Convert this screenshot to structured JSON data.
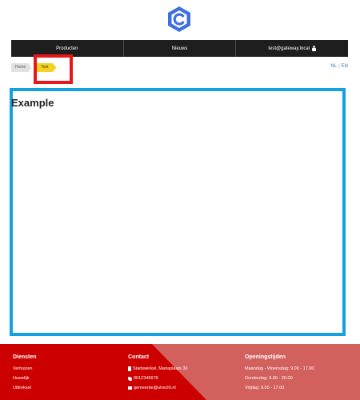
{
  "header": {
    "logo": "c-hexagon-logo"
  },
  "nav": {
    "items": [
      {
        "label": "Producten"
      },
      {
        "label": "Nieuws"
      },
      {
        "label": "test@gateway.local"
      }
    ]
  },
  "breadcrumb": {
    "home": "Home",
    "current": "Test"
  },
  "language": {
    "nl": "NL",
    "separator": "|",
    "en": "EN"
  },
  "main": {
    "title": "Example"
  },
  "footer": {
    "services": {
      "heading": "Diensten",
      "items": [
        "Verhuizen",
        "Huwelijk",
        "Uittreksel"
      ]
    },
    "contact": {
      "heading": "Contact",
      "address": "Stadswinkel, Mariaplaats 30",
      "phone": "0612345678",
      "email": "gemeente@utrecht.nl"
    },
    "hours": {
      "heading": "Openingstijden",
      "lines": [
        "Maandag - Woensdag: 9.00 - 17.00",
        "Donderdag: 9.00 - 20.00",
        "Vrijdag: 9.00 - 17.00"
      ]
    }
  },
  "colors": {
    "brand_blue": "#3f6fe0",
    "nav_bg": "#1e1e1e",
    "breadcrumb_active": "#f5d220",
    "highlight_red": "#e8161b",
    "highlight_blue": "#14a1e0",
    "footer_red": "#cd0000",
    "footer_accent": "#d2605d"
  }
}
